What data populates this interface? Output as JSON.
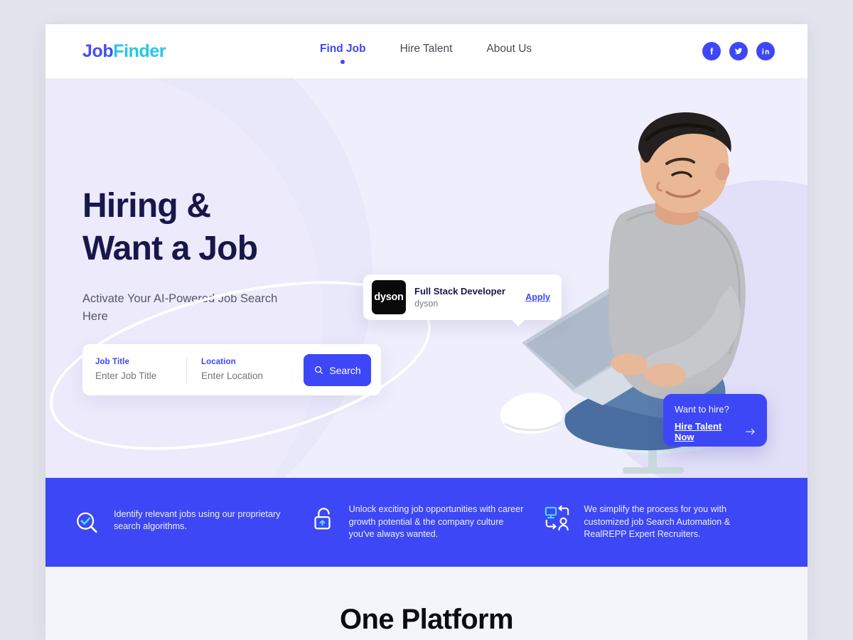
{
  "header": {
    "logo_primary": "Job",
    "logo_secondary": "Finder",
    "nav": [
      {
        "label": "Find Job",
        "active": true
      },
      {
        "label": "Hire Talent",
        "active": false
      },
      {
        "label": "About Us",
        "active": false
      }
    ],
    "socials": [
      {
        "name": "facebook-icon"
      },
      {
        "name": "twitter-icon"
      },
      {
        "name": "linkedin-icon"
      }
    ]
  },
  "hero": {
    "headline": "Hiring &\nWant a Job",
    "subhead": "Activate Your AI-Powered Job Search Here",
    "search": {
      "job_title_label": "Job Title",
      "job_title_placeholder": "Enter Job Title",
      "job_title_value": "",
      "location_label": "Location",
      "location_placeholder": "Enter Location",
      "location_value": "",
      "button_label": "Search"
    },
    "job_card": {
      "logo_text": "dyson",
      "title": "Full Stack Developer",
      "company": "dyson",
      "apply_label": "Apply"
    },
    "hire_card": {
      "question": "Want to hire?",
      "link_label": "Hire Talent Now"
    }
  },
  "features": [
    {
      "icon": "search-check-icon",
      "text": "Identify relevant jobs using our proprietary search algorithms."
    },
    {
      "icon": "unlock-icon",
      "text": "Unlock exciting job opportunities with career growth potential & the company culture you've always wanted."
    },
    {
      "icon": "monitor-person-exchange-icon",
      "text": "We simplify the process for you with customized job Search Automation & RealREPP Expert Recruiters."
    }
  ],
  "bottom": {
    "title": "One Platform"
  },
  "colors": {
    "brand_blue": "#3d47f5",
    "brand_cyan": "#24c6e8",
    "headline_navy": "#17174a",
    "hero_bg": "#efeefc",
    "page_bg": "#f4f5fa"
  }
}
